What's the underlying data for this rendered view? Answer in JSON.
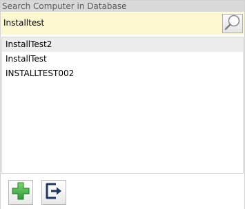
{
  "panel": {
    "title": "Search Computer in Database"
  },
  "search": {
    "value": "Installtest",
    "button_icon": "magnifier-icon"
  },
  "results": {
    "items": [
      {
        "label": "InstallTest2",
        "selected": true
      },
      {
        "label": "InstallTest",
        "selected": false
      },
      {
        "label": "INSTALLTEST002",
        "selected": false
      }
    ]
  },
  "toolbar": {
    "add_icon": "green-plus-icon",
    "exit_icon": "exit-arrow-icon"
  },
  "colors": {
    "title_bg": "#d9d9d9",
    "search_bg": "#fdf8cf",
    "selected_row_bg": "#ececec",
    "add_green": "#3bb54a",
    "exit_navy": "#1f3564"
  }
}
